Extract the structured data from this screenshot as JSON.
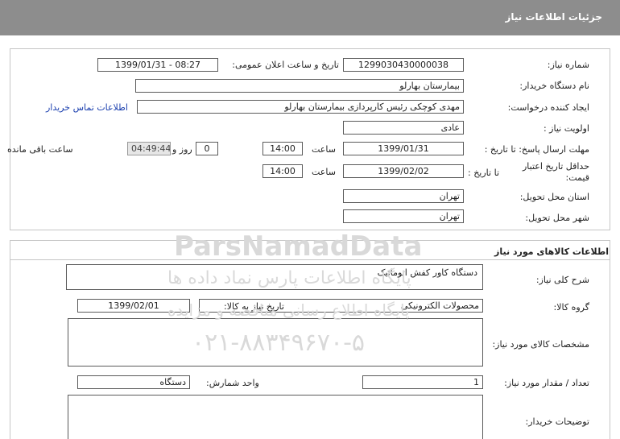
{
  "header": {
    "title": "جزئیات اطلاعات نیاز"
  },
  "need_info": {
    "need_number_label": "شماره نیاز:",
    "need_number": "1299030430000038",
    "announce_label": "تاریخ و ساعت اعلان عمومی:",
    "announce_value": "1399/01/31 - 08:27",
    "buyer_org_label": "نام دستگاه خریدار:",
    "buyer_org": "بیمارستان بهارلو",
    "creator_label": "ایجاد کننده درخواست:",
    "creator": "مهدی کوچکی  رئیس کارپردازی بیمارستان بهارلو",
    "contact_link": "اطلاعات تماس خریدار",
    "priority_label": "اولویت نیاز :",
    "priority": "عادی",
    "deadline_label": "مهلت ارسال پاسخ:  تا تاریخ :",
    "deadline_date": "1399/01/31",
    "time_label": "ساعت",
    "deadline_time": "14:00",
    "days_value": "0",
    "days_label": "روز و",
    "remaining_time": "04:49:44",
    "remaining_label": "ساعت باقی مانده",
    "validity_label": "حداقل تاریخ اعتبار قیمت:",
    "validity_to_label": "تا تاریخ :",
    "validity_date": "1399/02/02",
    "validity_time": "14:00",
    "province_label": "استان محل تحویل:",
    "province": "تهران",
    "city_label": "شهر محل تحویل:",
    "city": "تهران"
  },
  "goods_info": {
    "section_title": "اطلاعات کالاهای مورد نیاز",
    "description_label": "شرح کلی نیاز:",
    "description": "دستگاه کاور کفش اتوماتیک",
    "group_label": "گروه کالا:",
    "group": "محصولات الکترونیکی",
    "need_date_label": "تاریخ نیاز به کالا:",
    "need_date": "1399/02/01",
    "specs_label": "مشخصات کالای مورد نیاز:",
    "specs": "",
    "quantity_label": "تعداد / مقدار مورد نیاز:",
    "quantity": "1",
    "unit_label": "واحد شمارش:",
    "unit": "دستگاه",
    "buyer_notes_label": "توضیحات خریدار:",
    "buyer_notes": ""
  },
  "watermark": {
    "brand": "ParsNamadData",
    "line1": "پایگاه اطلاعات پارس نماد داده ها",
    "line2": "پایگاه اطلاع رسانی مناقصه و مزایده",
    "phone": "۰۲۱-۸۸۳۴۹۶۷۰-۵"
  }
}
